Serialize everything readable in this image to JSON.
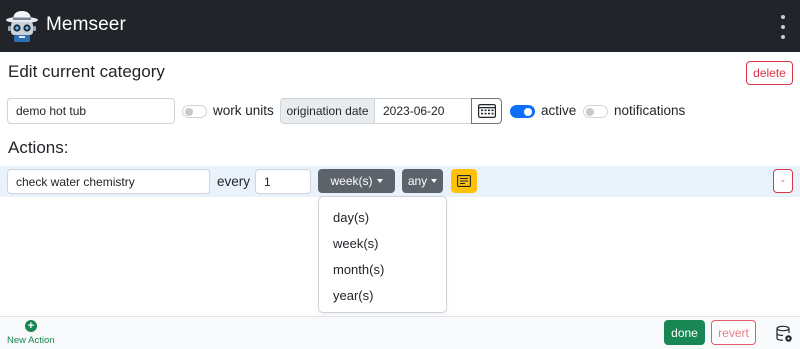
{
  "app": {
    "name": "Memseer"
  },
  "header": {
    "menu_icon": "kebab-vertical-icon"
  },
  "page": {
    "title": "Edit current category",
    "delete_label": "delete"
  },
  "category": {
    "name_value": "demo hot tub",
    "work_units": {
      "label": "work units",
      "checked": false
    },
    "origination_date": {
      "label": "origination date",
      "value": "2023-06-20"
    },
    "active": {
      "label": "active",
      "checked": true
    },
    "notifications": {
      "label": "notifications",
      "checked": false
    }
  },
  "actions": {
    "title": "Actions:",
    "items": [
      {
        "name_value": "check water chemistry",
        "every_label": "every",
        "interval_value": "1",
        "unit_label": "week(s)",
        "day_label": "any",
        "remove_label": "-"
      }
    ]
  },
  "unit_dropdown": {
    "options": [
      "day(s)",
      "week(s)",
      "month(s)",
      "year(s)"
    ]
  },
  "footer": {
    "new_action_label": "New Action",
    "done_label": "done",
    "revert_label": "revert"
  },
  "colors": {
    "navbar": "#212529",
    "primary": "#0d6efd",
    "success": "#198754",
    "danger": "#dc3545",
    "warning": "#ffc107",
    "secondary": "#5c636a",
    "row_highlight": "#e9f2fb"
  }
}
